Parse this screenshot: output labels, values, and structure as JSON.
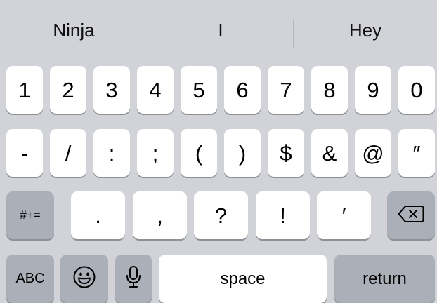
{
  "suggestions": [
    "Ninja",
    "I",
    "Hey"
  ],
  "row1": [
    "1",
    "2",
    "3",
    "4",
    "5",
    "6",
    "7",
    "8",
    "9",
    "0"
  ],
  "row2": [
    "-",
    "/",
    ":",
    ";",
    "(",
    ")",
    "$",
    "&",
    "@",
    "″"
  ],
  "row3": {
    "mode_label": "#+=",
    "keys": [
      ".",
      ",",
      "?",
      "!",
      "′"
    ],
    "delete_icon": "backspace-icon"
  },
  "row4": {
    "abc_label": "ABC",
    "emoji_icon": "emoji-icon",
    "mic_icon": "microphone-icon",
    "space_label": "space",
    "return_label": "return"
  },
  "colors": {
    "keyboard_bg": "#d1d3d9",
    "key_light": "#ffffff",
    "key_dark": "#abafb8",
    "key_shadow": "#8e9095"
  }
}
